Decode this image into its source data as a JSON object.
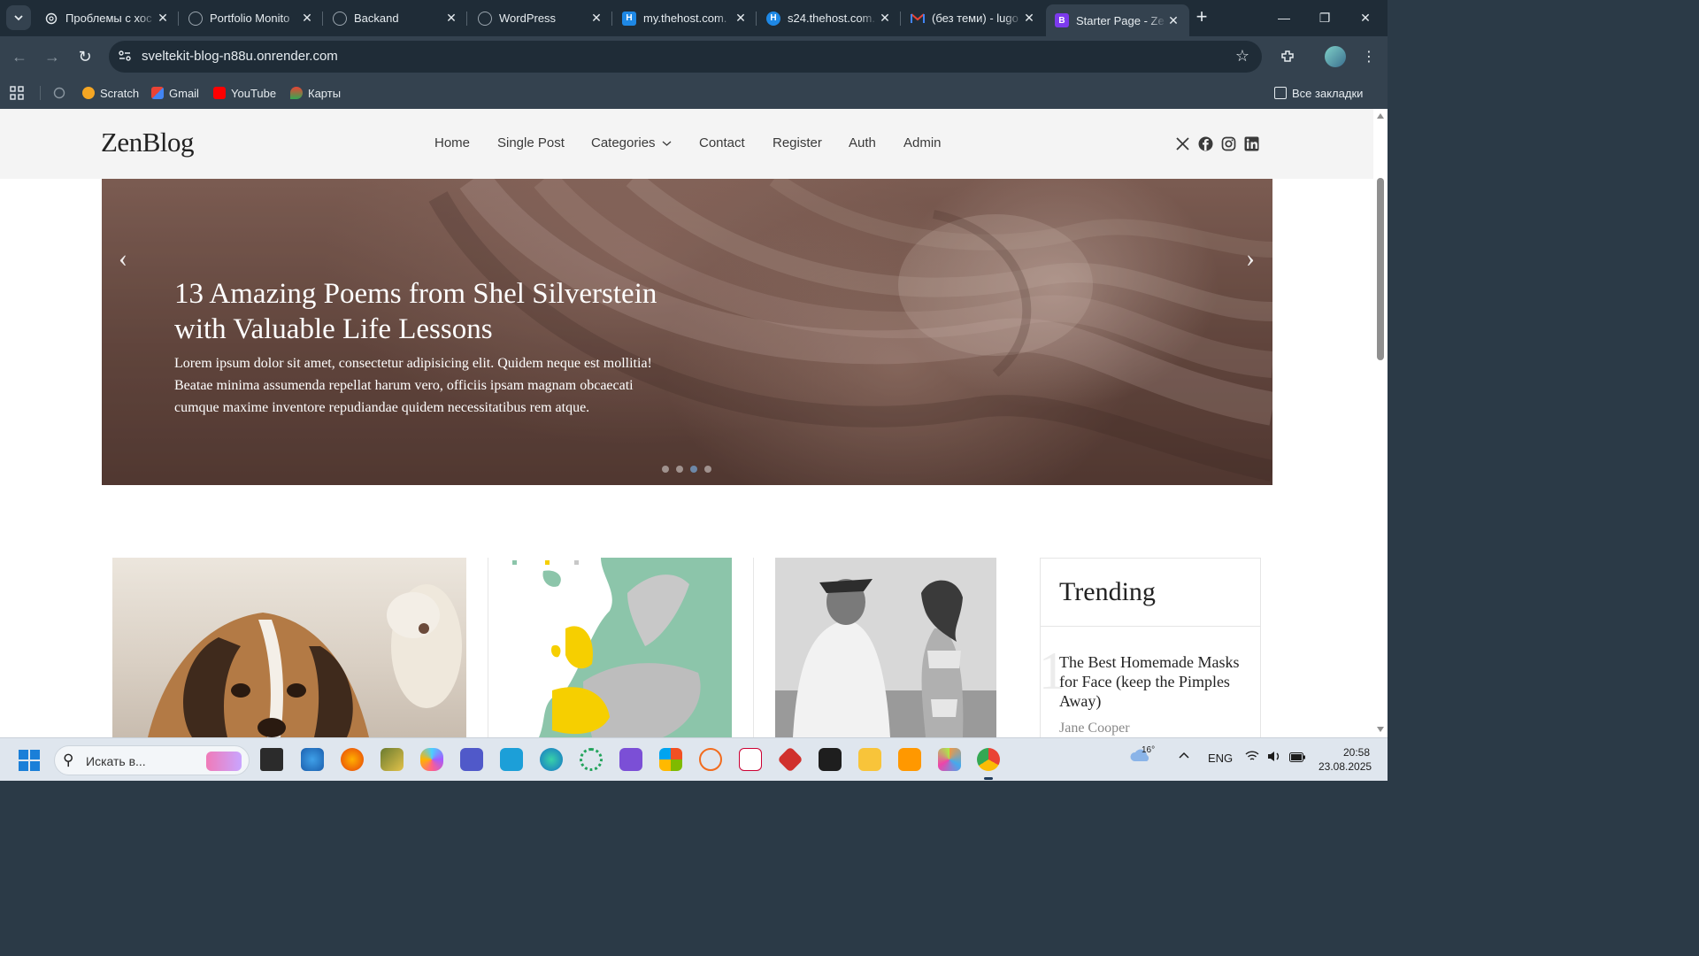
{
  "browser": {
    "tabs": [
      {
        "title": "Проблемы с хос",
        "favicon": "openai-icon",
        "color": "#e6ecf0"
      },
      {
        "title": "Portfolio Monito",
        "favicon": "globe-icon",
        "color": "#9aa5ae"
      },
      {
        "title": "Backand",
        "favicon": "globe-icon",
        "color": "#9aa5ae"
      },
      {
        "title": "WordPress",
        "favicon": "globe-icon",
        "color": "#9aa5ae"
      },
      {
        "title": "my.thehost.com.",
        "favicon": "H",
        "color": "#1e88e5"
      },
      {
        "title": "s24.thehost.com.",
        "favicon": "H",
        "color": "#1e88e5"
      },
      {
        "title": "(без теми) - lugo",
        "favicon": "gmail-icon",
        "color": "#ea4335"
      },
      {
        "title": "Starter Page - Ze",
        "favicon": "B",
        "color": "#7c3aed",
        "active": true
      }
    ],
    "url": "sveltekit-blog-n88u.onrender.com",
    "bookmarks": [
      {
        "label": "Scratch",
        "color": "#f5a623"
      },
      {
        "label": "Gmail",
        "color": "#ea4335"
      },
      {
        "label": "YouTube",
        "color": "#ff0000"
      },
      {
        "label": "Карты",
        "color": "#34a853"
      }
    ],
    "all_bookmarks": "Все закладки"
  },
  "site": {
    "logo": "ZenBlog",
    "nav": [
      {
        "label": "Home"
      },
      {
        "label": "Single Post"
      },
      {
        "label": "Categories",
        "dropdown": true
      },
      {
        "label": "Contact"
      },
      {
        "label": "Register"
      },
      {
        "label": "Auth"
      },
      {
        "label": "Admin"
      }
    ],
    "social": [
      "x-icon",
      "facebook-icon",
      "instagram-icon",
      "linkedin-icon"
    ],
    "hero": {
      "title": "13 Amazing Poems from Shel Silverstein with Valuable Life Lessons",
      "text": "Lorem ipsum dolor sit amet, consectetur adipisicing elit. Quidem neque est mollitia! Beatae minima assumenda repellat harum vero, officiis ipsam magnam obcaecati cumque maxime inventore repudiandae quidem necessitatibus rem atque.",
      "slide_count": 4,
      "active_slide": 3
    },
    "trending": {
      "heading": "Trending",
      "items": [
        {
          "rank": "1",
          "title": "The Best Homemade Masks for Face (keep the Pimples Away)",
          "author": "Jane Cooper"
        }
      ]
    }
  },
  "taskbar": {
    "search_placeholder": "Искать в...",
    "weather": "16°",
    "lang": "ENG",
    "time": "20:58",
    "date": "23.08.2025"
  }
}
